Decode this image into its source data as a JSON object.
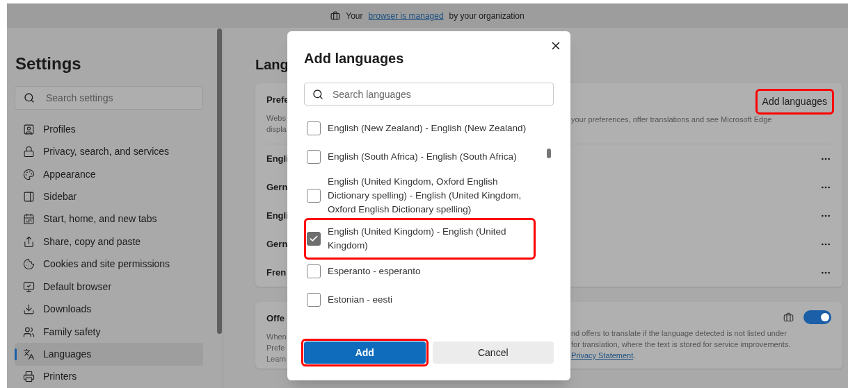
{
  "banner": {
    "prefix": "Your",
    "link": "browser is managed",
    "suffix": "by your organization"
  },
  "sidebar": {
    "title": "Settings",
    "search": {
      "placeholder": "Search settings"
    },
    "items": [
      {
        "label": "Profiles",
        "selected": false
      },
      {
        "label": "Privacy, search, and services",
        "selected": false
      },
      {
        "label": "Appearance",
        "selected": false
      },
      {
        "label": "Sidebar",
        "selected": false
      },
      {
        "label": "Start, home, and new tabs",
        "selected": false
      },
      {
        "label": "Share, copy and paste",
        "selected": false
      },
      {
        "label": "Cookies and site permissions",
        "selected": false
      },
      {
        "label": "Default browser",
        "selected": false
      },
      {
        "label": "Downloads",
        "selected": false
      },
      {
        "label": "Family safety",
        "selected": false
      },
      {
        "label": "Languages",
        "selected": true
      },
      {
        "label": "Printers",
        "selected": false
      }
    ]
  },
  "main": {
    "title": "Lang",
    "preferred_card": {
      "title": "Prefe",
      "description_left": [
        "Webs",
        "displa"
      ],
      "description_right": "your preferences, offer translations and see Microsoft Edge",
      "add_button": {
        "label": "Add languages",
        "highlighted": true
      },
      "rows": [
        {
          "label": "Engli"
        },
        {
          "label": "Gern"
        },
        {
          "label": "Engli"
        },
        {
          "label": "Gern"
        },
        {
          "label": "Fren"
        }
      ]
    },
    "offer_card": {
      "title": "Offe",
      "description_left": [
        "When",
        "Prefe",
        "Learn"
      ],
      "description_right": [
        "nd offers to translate if the language detected is not listed under",
        "for translation, where the text is stored for service improvements."
      ],
      "link": "Privacy Statement",
      "link_suffix": ".",
      "toggle_on": true
    }
  },
  "dialog": {
    "title": "Add languages",
    "search": {
      "placeholder": "Search languages"
    },
    "options": [
      {
        "label": "English (New Zealand) - English (New Zealand)",
        "checked": false,
        "highlighted": false
      },
      {
        "label": "English (South Africa) - English (South Africa)",
        "checked": false,
        "highlighted": false
      },
      {
        "label": "English (United Kingdom, Oxford English Dictionary spelling) - English (United Kingdom, Oxford English Dictionary spelling)",
        "checked": false,
        "highlighted": false
      },
      {
        "label": "English (United Kingdom) - English (United Kingdom)",
        "checked": true,
        "highlighted": true
      },
      {
        "label": "Esperanto - esperanto",
        "checked": false,
        "highlighted": false
      },
      {
        "label": "Estonian - eesti",
        "checked": false,
        "highlighted": false
      }
    ],
    "buttons": [
      {
        "label": "Add",
        "kind": "primary",
        "highlighted": true
      },
      {
        "label": "Cancel",
        "kind": "secondary",
        "highlighted": false
      }
    ]
  }
}
